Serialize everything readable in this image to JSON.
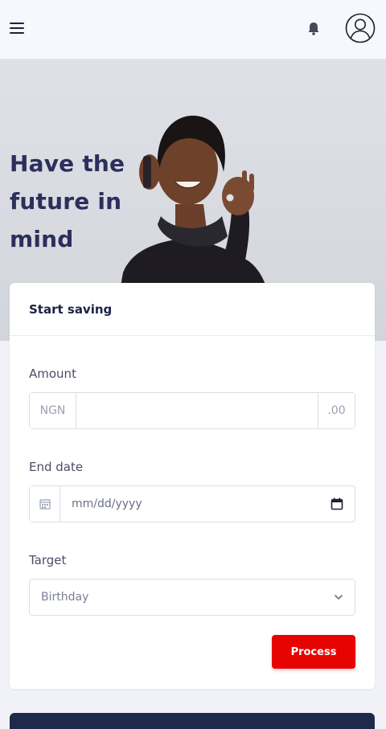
{
  "header": {
    "menu_icon": "hamburger-menu-icon",
    "notification_icon": "bell-icon",
    "profile_icon": "user-avatar-icon"
  },
  "hero": {
    "title_line1": "Have the",
    "title_line2": "future in",
    "title_line3": "mind"
  },
  "form": {
    "title": "Start saving",
    "amount": {
      "label": "Amount",
      "prefix": "NGN",
      "value": "",
      "suffix": ".00"
    },
    "end_date": {
      "label": "End date",
      "placeholder": "mm/dd/yyyy",
      "calendar_icon": "calendar-icon"
    },
    "target": {
      "label": "Target",
      "selected": "Birthday"
    },
    "submit_label": "Process"
  },
  "colors": {
    "primary_text": "#2c2e5c",
    "accent_button": "#e80303",
    "footer_panel": "#1d2a4b"
  }
}
